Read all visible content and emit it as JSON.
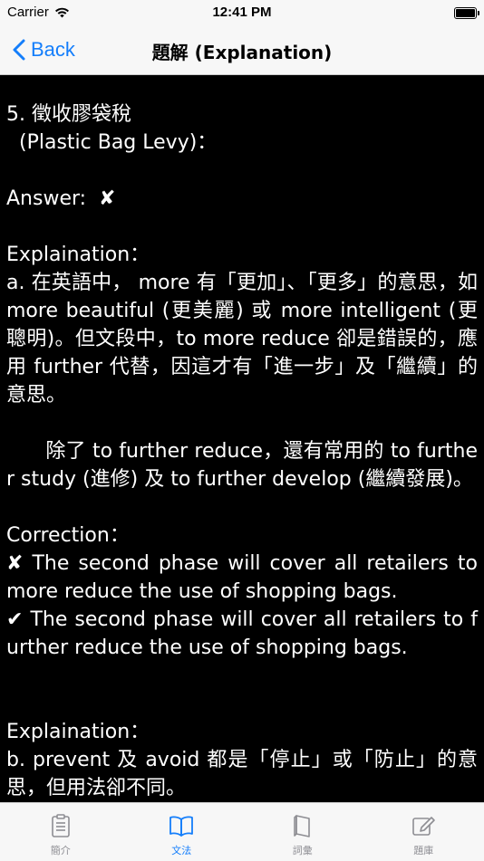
{
  "status_bar": {
    "carrier": "Carrier",
    "time": "12:41 PM"
  },
  "nav": {
    "back_label": "Back",
    "title": "題解 (Explanation)"
  },
  "content": {
    "text": "5. 徵收膠袋稅\n  (Plastic Bag Levy)：\n\nAnswer:  ✘\n\nExplaination：\na. 在英語中， more 有「更加」、「更多」的意思，如 more beautiful (更美麗) 或 more intelligent (更聰明)。但文段中，to more reduce 卻是錯誤的，應用 further 代替，因這才有「進一步」及「繼續」的意思。\n\n      除了 to further reduce，還有常用的 to further study (進修) 及 to further develop (繼續發展)。\n\nCorrection：\n✘ The second phase will cover all retailers to more reduce the use of shopping bags.\n✔ The second phase will cover all retailers to further reduce the use of shopping bags.\n\n\nExplaination：\nb. prevent 及 avoid 都是「停止」或「防止」的意思，但用法卻不同。"
  },
  "tabs": [
    {
      "label": "簡介",
      "icon": "clipboard-icon",
      "active": false
    },
    {
      "label": "文法",
      "icon": "book-icon",
      "active": true
    },
    {
      "label": "詞彙",
      "icon": "notebook-icon",
      "active": false
    },
    {
      "label": "題庫",
      "icon": "compose-icon",
      "active": false
    }
  ],
  "colors": {
    "accent": "#147efb",
    "inactive": "#8e8e93",
    "background": "#000000",
    "bar": "#f7f7f7"
  }
}
